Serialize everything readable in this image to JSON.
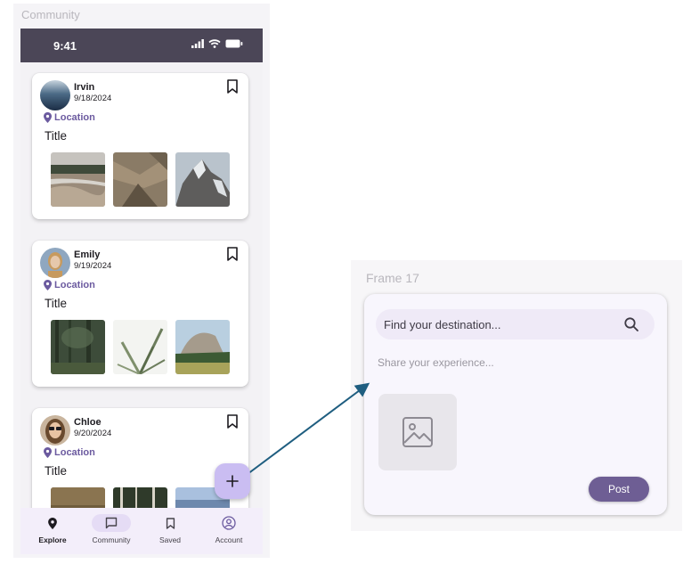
{
  "left_frame": {
    "label": "Community",
    "status_bar": {
      "time": "9:41"
    },
    "posts": [
      {
        "user": "Irvin",
        "date": "9/18/2024",
        "location": "Location",
        "title": "Title",
        "photos": [
          "beach-photo",
          "rock-texture-photo",
          "mountain-peak-photo"
        ]
      },
      {
        "user": "Emily",
        "date": "9/19/2024",
        "location": "Location",
        "title": "Title",
        "photos": [
          "forest-photo",
          "plant-leaves-photo",
          "half-dome-photo"
        ]
      },
      {
        "user": "Chloe",
        "date": "9/20/2024",
        "location": "Location",
        "title": "Title",
        "photos": [
          "canyon-photo",
          "forest-trees-photo",
          "sky-photo"
        ]
      }
    ],
    "fab_icon": "plus-icon",
    "bottom_nav": [
      {
        "label": "Explore",
        "icon": "location-pin-icon",
        "active": false
      },
      {
        "label": "Community",
        "icon": "chat-icon",
        "active": true
      },
      {
        "label": "Saved",
        "icon": "bookmark-icon",
        "active": false
      },
      {
        "label": "Account",
        "icon": "account-icon",
        "active": false
      }
    ]
  },
  "right_frame": {
    "label": "Frame 17",
    "search": {
      "placeholder": "Find your destination..."
    },
    "share_placeholder": "Share your experience...",
    "post_label": "Post"
  },
  "colors": {
    "status_bar": "#4b4657",
    "accent": "#6b5a9f",
    "fab": "#cabdf2",
    "post_button": "#6e5e94",
    "nav_active": "#e5dcf5"
  }
}
